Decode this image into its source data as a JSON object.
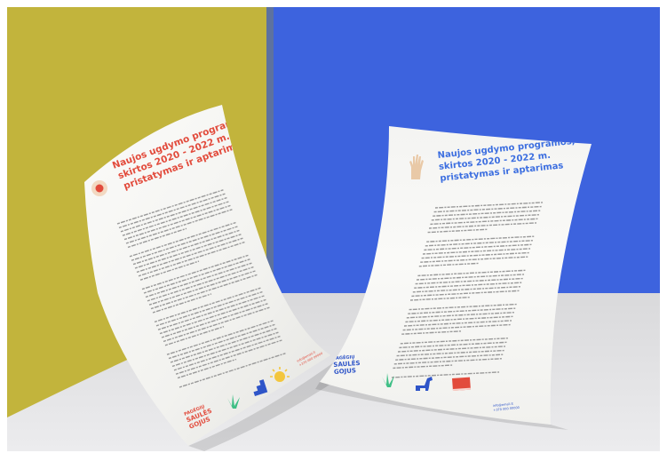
{
  "scene": {
    "description_free": true,
    "colors": {
      "left_wall": "#c2b43c",
      "right_wall": "#3d63de",
      "floor": "#e2e2e4",
      "paper": "#f7f7f5",
      "title_red": "#e24b3c",
      "title_blue": "#3d6fe0",
      "body_text": "#9a9a9a",
      "green": "#3fbf86",
      "blue_icon": "#2f55c8",
      "yellow": "#f3c63d",
      "hand": "#e9c9a7"
    }
  },
  "left_letter": {
    "title_lines": [
      "Naujos ugdymo programos,",
      "skirtos 2020 - 2022 m.",
      "pristatymas ir aptarimas"
    ],
    "logo_lines": [
      "PAGĖGIŲ",
      "SAULĖS",
      "GOJUS"
    ],
    "contact_lines": [
      "info@email.lt",
      "+370 000 00000"
    ],
    "icons": [
      "sun-badge-icon",
      "grass-icon",
      "stairs-icon",
      "sun-icon"
    ]
  },
  "right_letter": {
    "title_lines": [
      "Naujos ugdymo programos,",
      "skirtos 2020 - 2022 m.",
      "pristatymas ir aptarimas"
    ],
    "logo_lines": [
      "PAGĖGIŲ",
      "SAULĖS",
      "GOJUS"
    ],
    "contact_lines": [
      "info@email.lt",
      "+370 000 00000"
    ],
    "icons": [
      "hand-icon",
      "grass-icon",
      "dino-icon",
      "book-icon"
    ]
  }
}
